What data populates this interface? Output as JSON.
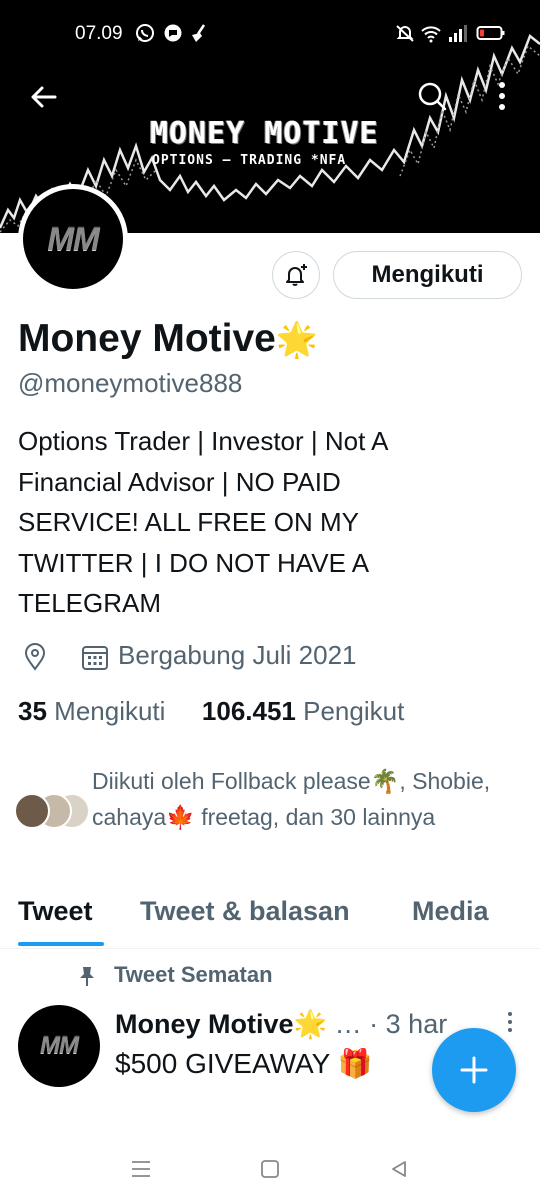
{
  "status_bar": {
    "time": "07.09",
    "left_icons": [
      "whatsapp-icon",
      "chat-bubble-icon",
      "broom-icon"
    ],
    "right_icons": [
      "mute-icon",
      "wifi-icon",
      "signal-icon",
      "battery-icon"
    ]
  },
  "header": {
    "banner_title": "MONEY MOTIVE",
    "banner_subtitle": "OPTIONS — TRADING   *NFA",
    "icons": [
      "back-arrow-icon",
      "search-icon",
      "more-vertical-icon"
    ]
  },
  "profile": {
    "avatar_text": "MM",
    "follow_button": "Mengikuti",
    "name": "Money Motive",
    "name_emoji": "🌟",
    "handle": "@moneymotive888",
    "bio": "Options Trader | Investor | Not A Financial Advisor | NO PAID SERVICE! ALL FREE ON MY TWITTER | I DO NOT HAVE A TELEGRAM",
    "joined": "Bergabung Juli 2021",
    "following_count": "35",
    "following_label": "Mengikuti",
    "followers_count": "106.451",
    "followers_label": "Pengikut",
    "followed_by": "Diikuti oleh Follback please🌴, Shobie, cahaya🍁 freetag, dan 30 lainnya"
  },
  "tabs": [
    {
      "label": "Tweet",
      "active": true
    },
    {
      "label": "Tweet & balasan",
      "active": false
    },
    {
      "label": "Media",
      "active": false
    }
  ],
  "pinned_tweet": {
    "pinned_label": "Tweet Sematan",
    "author": "Money Motive🌟",
    "ellipsis": "…",
    "time": "· 3 har",
    "text": "$500 GIVEAWAY 🎁",
    "avatar_text": "MM"
  },
  "colors": {
    "accent": "#1d9bf0",
    "text": "#0f1419",
    "secondary": "#536471",
    "banner": "#000000"
  }
}
